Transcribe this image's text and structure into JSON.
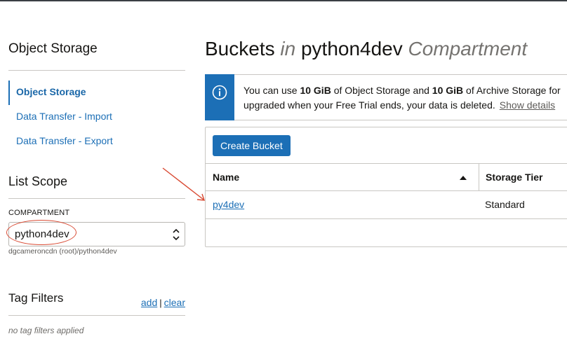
{
  "sidebar": {
    "title": "Object Storage",
    "nav": [
      {
        "label": "Object Storage",
        "active": true
      },
      {
        "label": "Data Transfer - Import",
        "active": false
      },
      {
        "label": "Data Transfer - Export",
        "active": false
      }
    ],
    "list_scope": {
      "title": "List Scope",
      "compartment_label": "COMPARTMENT",
      "compartment_value": "python4dev",
      "compartment_path": "dgcameroncdn (root)/python4dev"
    },
    "tag_filters": {
      "title": "Tag Filters",
      "add_label": "add",
      "separator": "|",
      "clear_label": "clear",
      "empty_text": "no tag filters applied"
    }
  },
  "header": {
    "title_part1": "Buckets",
    "title_in": "in",
    "title_compartment": "python4dev",
    "title_suffix": "Compartment"
  },
  "banner": {
    "line1_a": "You can use",
    "line1_b": "10 GiB",
    "line1_c": "of Object Storage and",
    "line1_d": "10 GiB",
    "line1_e": "of Archive Storage for",
    "line2": "upgraded when your Free Trial ends, your data is deleted.",
    "show_details": "Show details"
  },
  "toolbar": {
    "create_bucket_label": "Create Bucket"
  },
  "table": {
    "columns": [
      "Name",
      "Storage Tier"
    ],
    "rows": [
      {
        "name": "py4dev",
        "storage_tier": "Standard"
      }
    ]
  },
  "colors": {
    "accent": "#1c6fb6",
    "annotation": "#d94a33"
  }
}
